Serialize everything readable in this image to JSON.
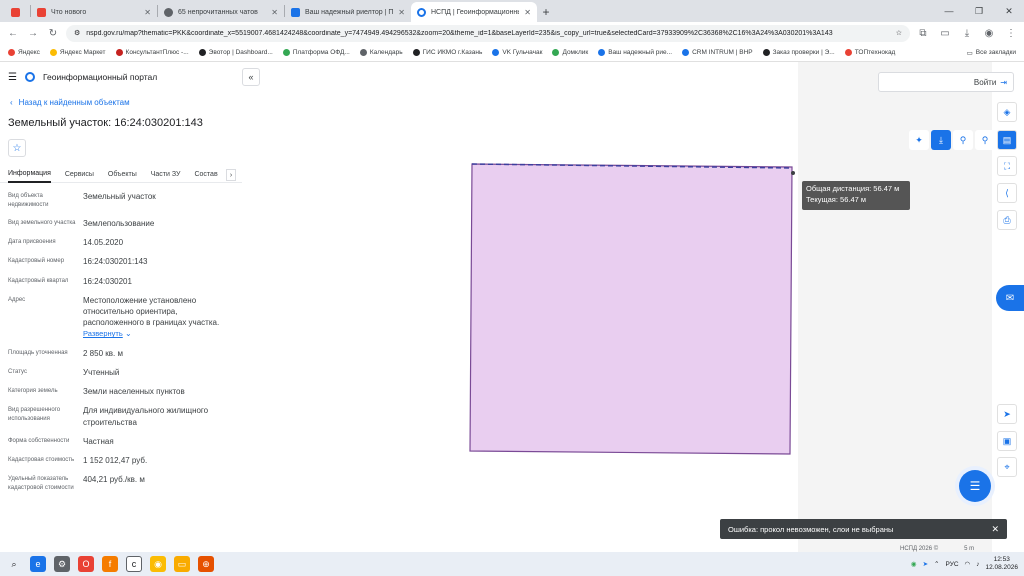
{
  "browser": {
    "tabs": [
      {
        "title": "Что нового",
        "color": "#e94235",
        "active": false
      },
      {
        "title": "65 непрочитанных чатов",
        "color": "#5f6368",
        "active": false
      },
      {
        "title": "Ваш надежный риелтор | Про",
        "color": "#1a73e8",
        "active": false
      },
      {
        "title": "НСПД | Геоинформационный",
        "color": "#1a73e8",
        "active": true
      }
    ],
    "url": "nspd.gov.ru/map?thematic=PKK&coordinate_x=5519007.4681424248&coordinate_y=7474949.494296532&zoom=20&theme_id=1&baseLayerId=235&is_copy_url=true&selectedCard=37933909%2C36368%2C16%3A24%3A030201%3A143",
    "bookmarks": [
      {
        "label": "Яндекс",
        "color": "#e94235"
      },
      {
        "label": "Яндекс Маркет",
        "color": "#fbbc04"
      },
      {
        "label": "КонсультантПлюс -...",
        "color": "#c5221f"
      },
      {
        "label": "Эвотор | Dashboard...",
        "color": "#202124"
      },
      {
        "label": "Платформа ОФД...",
        "color": "#34a853"
      },
      {
        "label": "Календарь",
        "color": "#5f6368"
      },
      {
        "label": "ГИС ИКМО г.Казань",
        "color": "#202124"
      },
      {
        "label": "VK Гульчачак",
        "color": "#1a73e8"
      },
      {
        "label": "Домклик",
        "color": "#34a853"
      },
      {
        "label": "Ваш надежный рие...",
        "color": "#1a73e8"
      },
      {
        "label": "CRM INTRUM | ВНР",
        "color": "#1a73e8"
      },
      {
        "label": "Заказ проверки | Э...",
        "color": "#202124"
      },
      {
        "label": "ТОПтехнокад",
        "color": "#e94235"
      }
    ],
    "all_bookmarks": "Все закладки"
  },
  "portal": {
    "name": "Геоинформационный портал",
    "back_link": "Назад к найденным объектам",
    "object_title": "Земельный участок: 16:24:030201:143",
    "tabs": [
      "Информация",
      "Сервисы",
      "Объекты",
      "Части ЗУ",
      "Состав"
    ],
    "properties": [
      {
        "key": "Вид объекта недвижимости",
        "value": "Земельный участок"
      },
      {
        "key": "Вид земельного участка",
        "value": "Землепользование"
      },
      {
        "key": "Дата присвоения",
        "value": "14.05.2020"
      },
      {
        "key": "Кадастровый номер",
        "value": "16:24:030201:143"
      },
      {
        "key": "Кадастровый квартал",
        "value": "16:24:030201"
      },
      {
        "key": "Адрес",
        "value": "Местоположение установлено относительно ориентира, расположенного в границах участка."
      },
      {
        "key": "Площадь уточненная",
        "value": "2 850 кв. м"
      },
      {
        "key": "Статус",
        "value": "Учтенный"
      },
      {
        "key": "Категория земель",
        "value": "Земли населенных пунктов"
      },
      {
        "key": "Вид разрешенного использования",
        "value": "Для индивидуального жилищного строительства"
      },
      {
        "key": "Форма собственности",
        "value": "Частная"
      },
      {
        "key": "Кадастровая стоимость",
        "value": "1 152 012,47 руб."
      },
      {
        "key": "Удельный показатель кадастровой стоимости",
        "value": "404,21 руб./кв. м"
      }
    ],
    "expand_label": "Развернуть"
  },
  "map": {
    "login_label": "Войти",
    "tooltip_total": "Общая дистанция: 56.47 м",
    "tooltip_current": "Текущая: 56.47 м",
    "error_message": "Ошибка: прокол невозможен, слои не выбраны",
    "footer_brand": "НСПД 2026 ©",
    "footer_scale": "5 m",
    "parcel_fill": "#e9cef0",
    "parcel_stroke": "#7a4a96"
  },
  "taskbar": {
    "lang": "РУС",
    "time": "12:53",
    "date": "12.08.2026"
  }
}
